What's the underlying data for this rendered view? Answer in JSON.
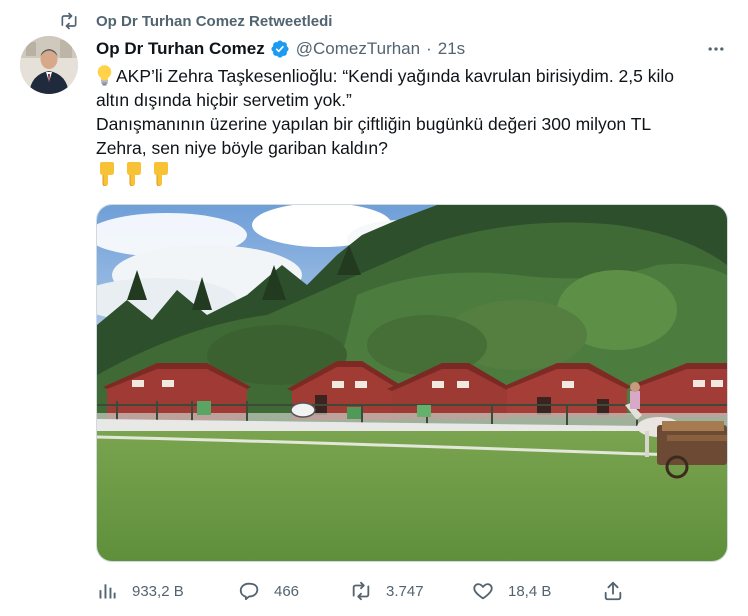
{
  "retweet_bar": {
    "label": "Op Dr Turhan Comez Retweetledi",
    "icon": "retweet-icon"
  },
  "tweet": {
    "author_name": "Op Dr Turhan Comez",
    "handle": "@ComezTurhan",
    "separator": "·",
    "time": "21s",
    "verified": true,
    "text_lines": [
      "AKP’li Zehra Taşkesenlioğlu: “Kendi yağında kavrulan birisiydim. 2,5 kilo",
      "altın dışında hiçbir servetim yok.”",
      "Danışmanının üzerine yapılan bir çiftliğin bugünkü değeri 300 milyon TL",
      "Zehra, sen niye böyle gariban kaldın?"
    ],
    "leading_emoji": "light-bulb-emoji",
    "trailing_emojis": [
      "backhand-index-pointing-down",
      "backhand-index-pointing-down",
      "backhand-index-pointing-down"
    ],
    "media": {
      "type": "video-thumbnail",
      "icon": "farm-video"
    }
  },
  "actions": {
    "views": {
      "icon": "views-icon",
      "count": "933,2 B"
    },
    "reply": {
      "icon": "reply-icon",
      "count": "466"
    },
    "retweet": {
      "icon": "retweet-icon",
      "count": "3.747"
    },
    "like": {
      "icon": "heart-icon",
      "count": "18,4 B"
    },
    "share": {
      "icon": "share-icon"
    }
  },
  "colors": {
    "text": "#0f1419",
    "secondary": "#536471",
    "verified_blue": "#1d9bf0",
    "border": "#cfd9de"
  }
}
